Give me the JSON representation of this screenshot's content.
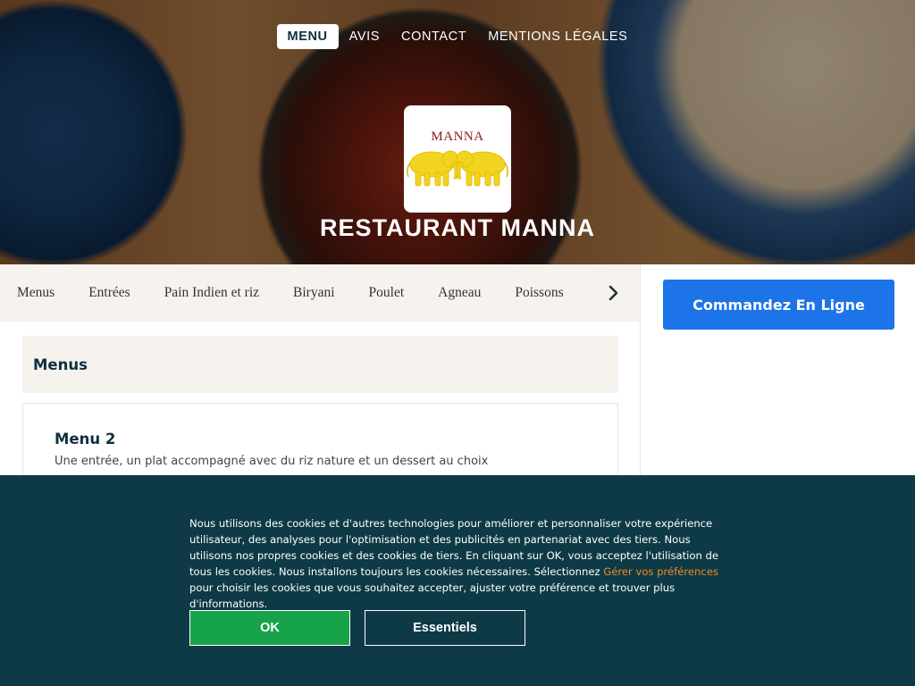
{
  "nav": {
    "items": [
      {
        "label": "MENU",
        "active": true
      },
      {
        "label": "AVIS",
        "active": false
      },
      {
        "label": "CONTACT",
        "active": false
      },
      {
        "label": "MENTIONS LÉGALES",
        "active": false
      }
    ]
  },
  "logo": {
    "text": "MANNA"
  },
  "hero": {
    "title": "RESTAURANT MANNA"
  },
  "categories": [
    "Menus",
    "Entrées",
    "Pain Indien et riz",
    "Biryani",
    "Poulet",
    "Agneau",
    "Poissons"
  ],
  "order_button": "Commandez En Ligne",
  "section": {
    "title": "Menus",
    "items": [
      {
        "name": "Menu 2",
        "description": "Une entrée, un plat accompagné avec du riz nature et un dessert au choix"
      }
    ]
  },
  "cookie": {
    "text_before": "Nous utilisons des cookies et d'autres technologies pour améliorer et personnaliser votre expérience utilisateur, des analyses pour l'optimisation et des publicités en partenariat avec des tiers. Nous utilisons nos propres cookies et des cookies de tiers. En cliquant sur OK, vous acceptez l'utilisation de tous les cookies. Nous installons toujours les cookies nécessaires. Sélectionnez ",
    "link": "Gérer vos préférences",
    "text_after": " pour choisir les cookies que vous souhaitez accepter, ajuster votre préférence et trouver plus d'informations.",
    "ok_label": "OK",
    "essential_label": "Essentiels"
  },
  "colors": {
    "accent_blue": "#1c74e8",
    "ok_green": "#17a34a",
    "banner_bg": "#0e3a47",
    "link_orange": "#f08a24",
    "logo_red": "#8c1c24",
    "elephant_yellow": "#f2d320"
  }
}
